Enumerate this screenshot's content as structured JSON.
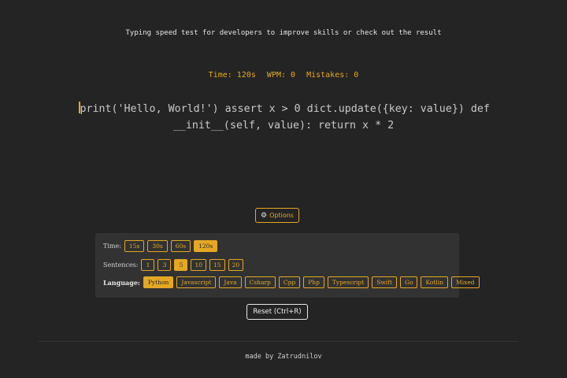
{
  "header": {
    "tagline": "Typing speed test for developers to improve skills or check out the result"
  },
  "stats": {
    "time": "Time: 120s",
    "wpm": "WPM: 0",
    "mistakes": "Mistakes: 0"
  },
  "code": {
    "line1": "print('Hello, World!') assert x > 0 dict.update({key: value}) def",
    "line2": "__init__(self, value): return x * 2"
  },
  "options_button": {
    "icon": "gear-icon",
    "label": "Options"
  },
  "options": {
    "time": {
      "label": "Time:",
      "values": [
        "15s",
        "30s",
        "60s",
        "120s"
      ],
      "selected": "120s"
    },
    "sentences": {
      "label": "Sentences:",
      "values": [
        "1",
        "3",
        "5",
        "10",
        "15",
        "20"
      ],
      "selected": "5"
    },
    "language": {
      "label": "Language:",
      "values": [
        "Python",
        "Javascript",
        "Java",
        "Csharp",
        "Cpp",
        "Php",
        "Typescript",
        "Swift",
        "Go",
        "Kotlin",
        "Mixed"
      ],
      "selected": "Python"
    }
  },
  "reset_button": {
    "label": "Reset (Ctrl+R)"
  },
  "footer": {
    "text": "made by Zatrudnilov"
  },
  "colors": {
    "accent": "#e5a823",
    "background": "#242424",
    "panel": "#323232"
  }
}
